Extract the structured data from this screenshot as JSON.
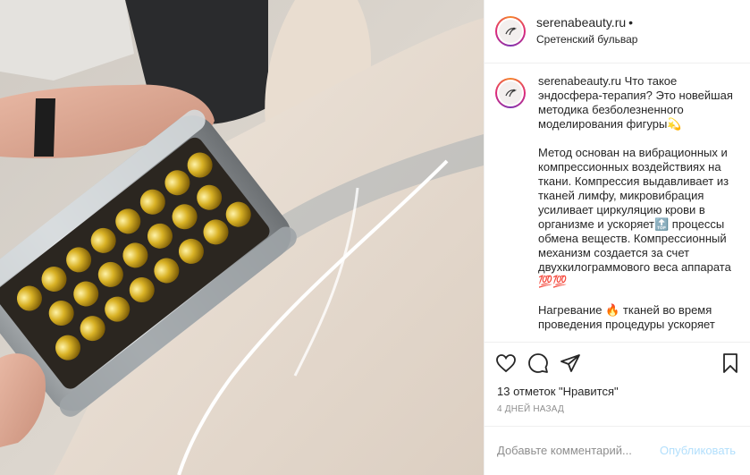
{
  "colors": {
    "text": "#262626",
    "muted": "#8e8e8e",
    "publish_disabled": "#b2dffc",
    "divider": "#efefef"
  },
  "post": {
    "photo_icon": "endosphere-roller-photo",
    "header": {
      "username": "serenabeauty.ru",
      "separator": "•",
      "location": "Сретенский бульвар"
    },
    "caption": {
      "username": "serenabeauty.ru",
      "lines": [
        "Что такое эндосфера-терапия? Это новейшая методика безболезненного моделирования фигуры💫",
        "Метод основан на вибрационных и компрессионных воздействиях на ткани. Компрессия выдавливает из тканей лимфу, микровибрация усиливает циркуляцию крови в организме и ускоряет🔝 процессы обмена веществ. Компрессионный механизм создается за счет двухкилограммового веса аппарата 💯💯",
        "Нагревание 🔥 тканей во время проведения процедуры ускоряет синтез коллагена и эластина, это"
      ]
    },
    "actions": {
      "like_icon": "heart-icon",
      "comment_icon": "comment-icon",
      "share_icon": "share-icon",
      "save_icon": "bookmark-icon"
    },
    "likes_text": "13 отметок \"Нравится\"",
    "date": "4 ДНЕЙ НАЗАД",
    "comment_box": {
      "placeholder": "Добавьте комментарий...",
      "publish_label": "Опубликовать"
    }
  }
}
